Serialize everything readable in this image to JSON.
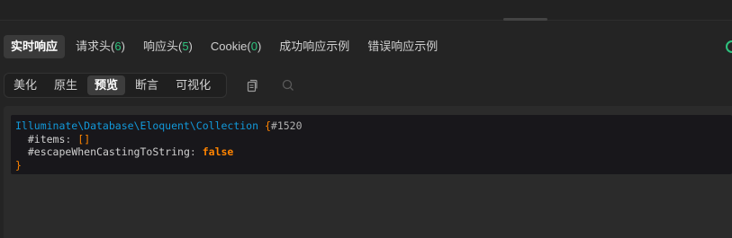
{
  "response_tabs": [
    {
      "label": "实时响应",
      "active": true
    },
    {
      "label": "请求头",
      "count": "6"
    },
    {
      "label": "响应头",
      "count": "5"
    },
    {
      "label": "Cookie",
      "count": "0"
    },
    {
      "label": "成功响应示例"
    },
    {
      "label": "错误响应示例"
    }
  ],
  "view_modes": [
    {
      "label": "美化"
    },
    {
      "label": "原生"
    },
    {
      "label": "预览",
      "active": true
    },
    {
      "label": "断言"
    },
    {
      "label": "可视化"
    }
  ],
  "code": {
    "class_name": "Illuminate\\Database\\Eloquent\\Collection",
    "open_brace": "{",
    "object_id": "#1520",
    "line2_prop": "#items",
    "line2_sep": ": ",
    "line2_value": "[]",
    "line3_prop": "#escapeWhenCastingToString",
    "line3_sep": ": ",
    "line3_value": "false",
    "close_brace": "}"
  },
  "icons": {
    "copy": "copy-icon",
    "search": "search-icon",
    "status": "status-indicator-icon"
  },
  "colors": {
    "accent_green": "#2ec27e",
    "class_blue": "#1299da",
    "brace_orange": "#ff8400",
    "background": "#242424"
  }
}
